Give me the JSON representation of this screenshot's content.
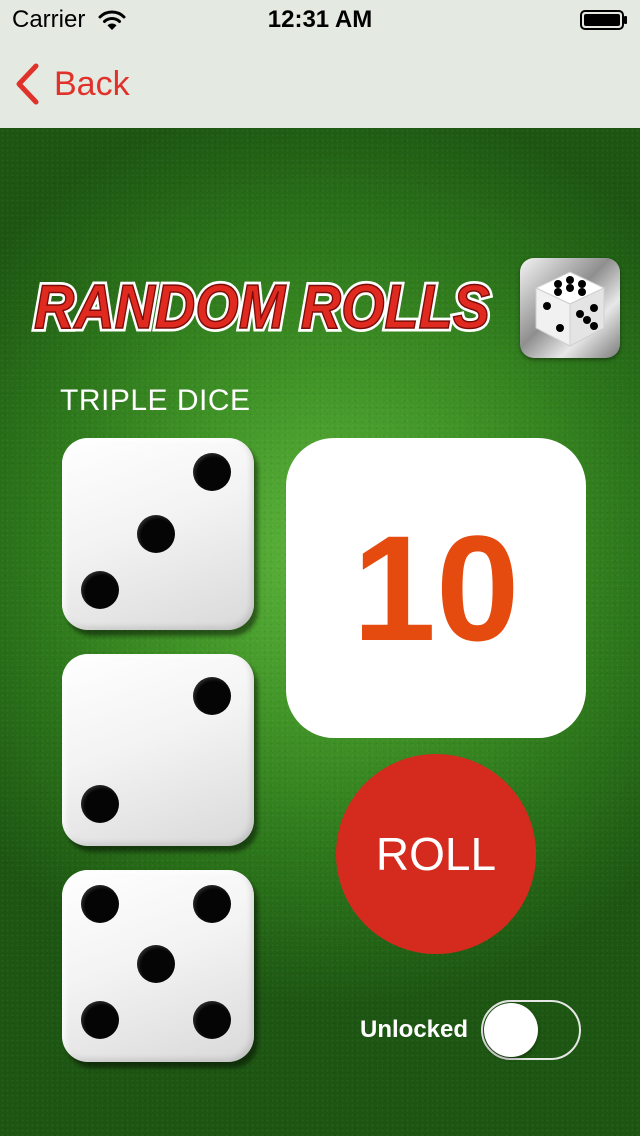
{
  "status_bar": {
    "carrier": "Carrier",
    "time": "12:31 AM",
    "wifi_icon": "wifi-icon",
    "battery_icon": "battery-full-icon"
  },
  "nav": {
    "back_label": "Back",
    "back_icon": "chevron-left-icon",
    "accent_color": "#e0322a"
  },
  "header": {
    "logo_text": "RANDOM ROLLS",
    "logo_icon": "dice-icon"
  },
  "game": {
    "mode_label": "TRIPLE DICE",
    "dice": [
      3,
      2,
      5
    ],
    "result": "10",
    "result_color": "#e54b0f",
    "roll_label": "ROLL",
    "roll_color": "#d52b1e",
    "unlock_label": "Unlocked",
    "unlocked": false
  }
}
